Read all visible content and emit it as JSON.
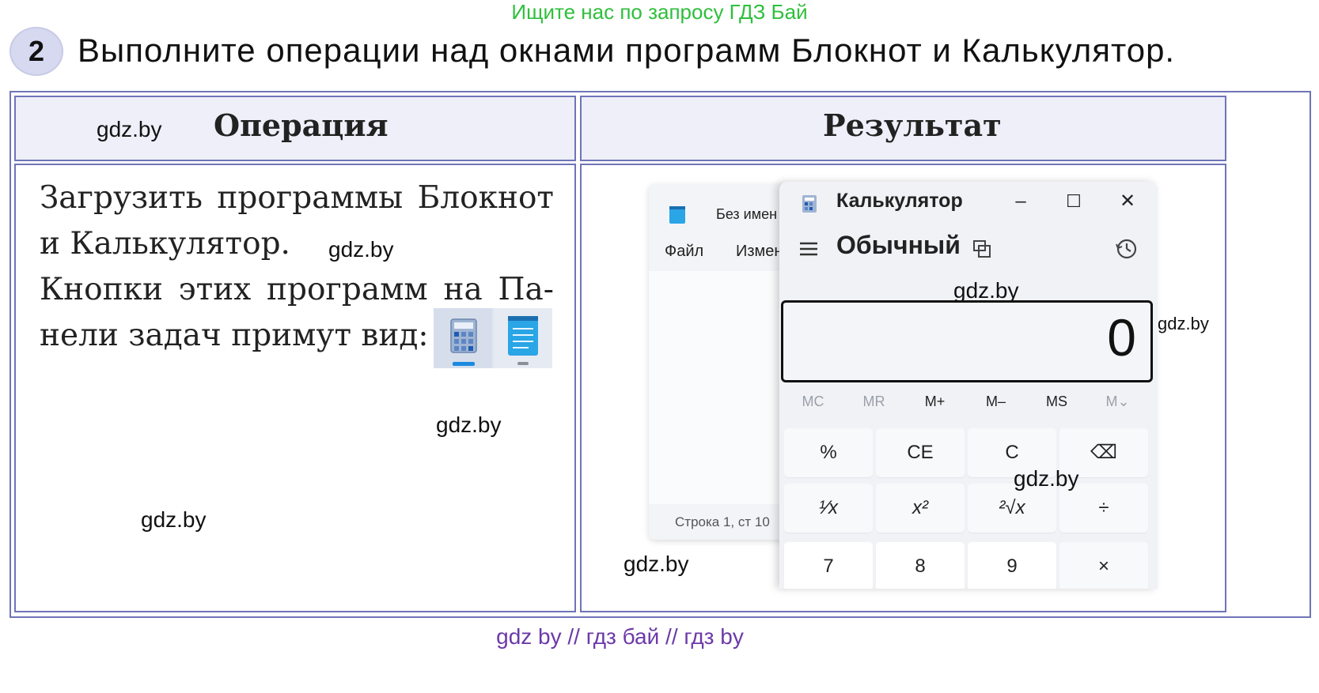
{
  "banner": "Ищите нас по запросу ГДЗ Бай",
  "task": {
    "number": "2",
    "text": "Выполните операции над окнами программ Блокнот и Калькулятор."
  },
  "table": {
    "header_operation": "Операция",
    "header_result": "Результат",
    "operation_lines": [
      "Загрузить программы Блокнот",
      "и Калькулятор.",
      "Кнопки этих программ на Па-",
      "нели задач примут вид:"
    ]
  },
  "watermarks": {
    "w1": "gdz.by",
    "w2": "gdz.by",
    "w3": "gdz.by",
    "w4": "gdz.by",
    "w5": "gdz.by",
    "w6": "gdz.by",
    "w7": "gdz.by",
    "w8": "gdz.by"
  },
  "notepad": {
    "title": "Без имен",
    "menu_file": "Файл",
    "menu_edit": "Измен",
    "status": "Строка 1, ст   10"
  },
  "calculator": {
    "title": "Калькулятор",
    "mode": "Обычный",
    "display": "0",
    "minimize": "–",
    "maximize": "☐",
    "close": "✕",
    "memory": [
      "MC",
      "MR",
      "M+",
      "M–",
      "MS",
      "M⌄"
    ],
    "keys_row1": [
      "%",
      "CE",
      "C",
      "⌫"
    ],
    "keys_row2": [
      "¹⁄x",
      "x²",
      "²√x",
      "÷"
    ],
    "keys_row3": [
      "7",
      "8",
      "9",
      "×"
    ]
  },
  "footer": "gdz by  //  гдз бай  //  гдз by",
  "colors": {
    "banner": "#2fbf3c",
    "table_border": "#6f74b8",
    "footer": "#6c3aa8",
    "header_bg": "#eeeff9"
  }
}
